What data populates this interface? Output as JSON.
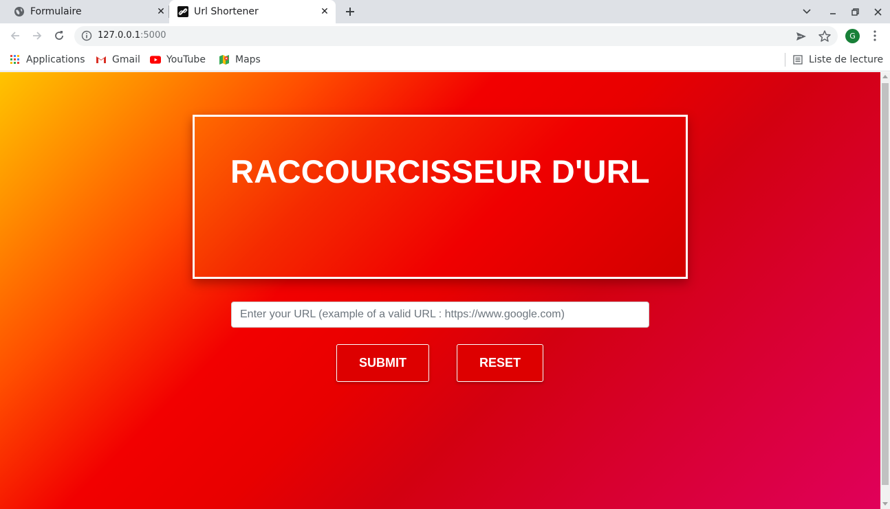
{
  "browser": {
    "tabs": [
      {
        "title": "Formulaire",
        "favicon": "globe-icon",
        "active": false
      },
      {
        "title": "Url Shortener",
        "favicon": "link-icon",
        "active": true
      }
    ],
    "address": {
      "host": "127.0.0.1",
      "port": ":5000"
    },
    "profile_initial": "G",
    "bookmarks": [
      {
        "label": "Applications",
        "icon": "apps-grid-icon"
      },
      {
        "label": "Gmail",
        "icon": "gmail-icon"
      },
      {
        "label": "YouTube",
        "icon": "youtube-icon"
      },
      {
        "label": "Maps",
        "icon": "maps-icon"
      }
    ],
    "reading_list": "Liste de lecture"
  },
  "page": {
    "heading": "RACCOURCISSEUR D'URL",
    "url_placeholder": "Enter your URL (example of a valid URL : https://www.google.com)",
    "submit_label": "SUBMIT",
    "reset_label": "RESET"
  },
  "colors": {
    "gradient_start": "#ffc400",
    "gradient_mid": "#f20000",
    "gradient_end": "#e0005a",
    "button_bg": "#dd0000",
    "profile_bg": "#188038"
  }
}
